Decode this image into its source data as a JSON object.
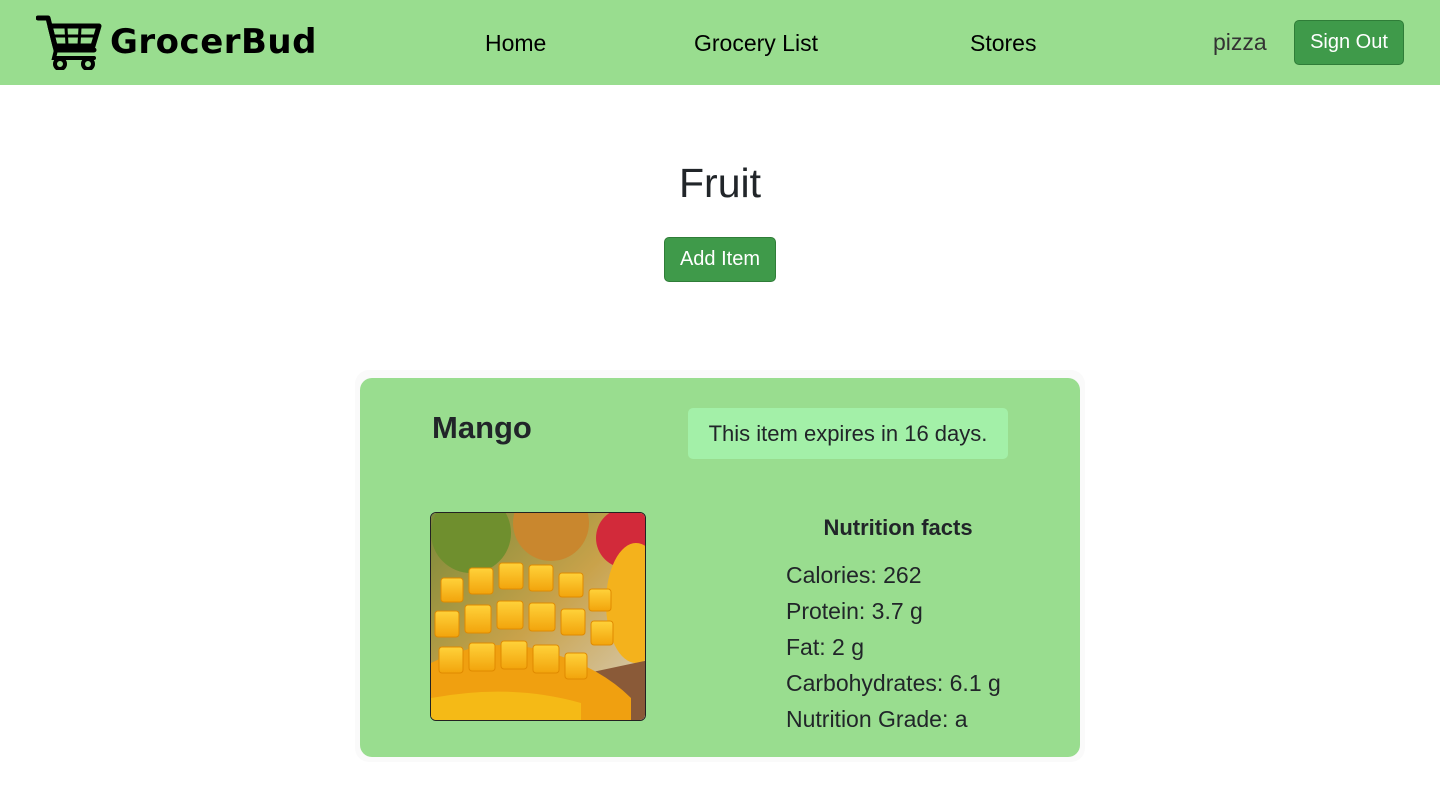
{
  "navbar": {
    "brand": "GrocerBud",
    "links": [
      "Home",
      "Grocery List",
      "Stores"
    ],
    "username": "pizza",
    "sign_out": "Sign Out"
  },
  "page": {
    "title": "Fruit",
    "add_item_label": "Add Item"
  },
  "item": {
    "name": "Mango",
    "expiry_text": "This item expires in 16 days.",
    "nutrition_title": "Nutrition facts",
    "nutrition": [
      "Calories: 262",
      "Protein: 3.7 g",
      "Fat: 2 g",
      "Carbohydrates: 6.1 g",
      "Nutrition Grade: a"
    ]
  },
  "colors": {
    "navbar_bg": "#99dd8f",
    "button_green": "#3f9a4a",
    "card_bg": "#99dd8f",
    "expiry_bg": "#a3f0a8"
  },
  "icons": [
    "shopping-cart-icon"
  ]
}
